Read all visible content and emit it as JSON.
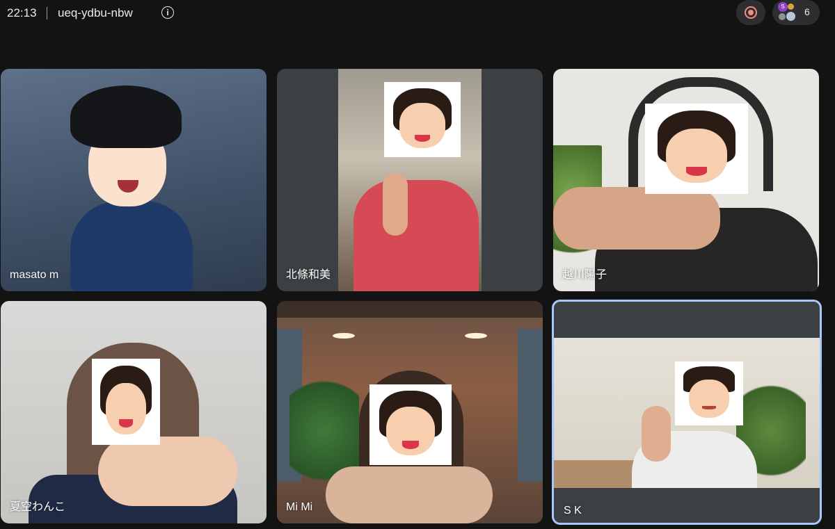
{
  "header": {
    "time": "22:13",
    "meeting_code": "ueq-ydbu-nbw",
    "info_icon": "info-icon",
    "info_glyph": "i"
  },
  "controls": {
    "record_icon": "record-icon",
    "participant_initial": "S",
    "participant_count": "6"
  },
  "participants": [
    {
      "name": "masato m"
    },
    {
      "name": "北條和美"
    },
    {
      "name": "越川陽子"
    },
    {
      "name": "夏空わんこ"
    },
    {
      "name": "Mi Mi"
    },
    {
      "name": "S K"
    }
  ],
  "colors": {
    "background": "#131314",
    "tile": "#3c4043",
    "active_speaker_border": "#a8c7fa",
    "record": "#f28b82"
  }
}
